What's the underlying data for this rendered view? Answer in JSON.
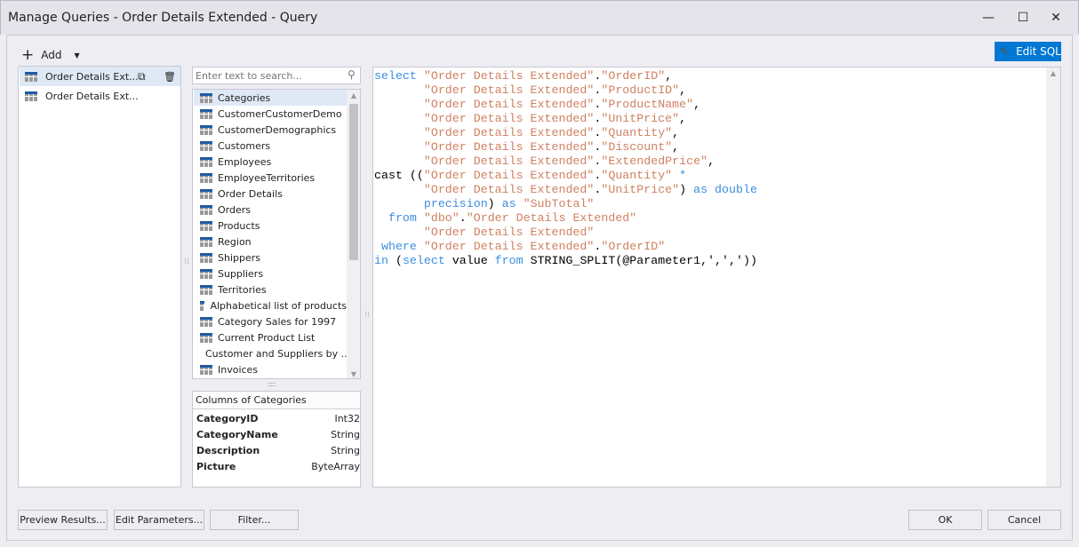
{
  "window": {
    "title": "Manage Queries - Order Details Extended - Query",
    "minimize": "—",
    "maximize": "☐",
    "close": "✕"
  },
  "toolbar": {
    "add_label": "Add",
    "edit_sql_label": "Edit SQL"
  },
  "queries": [
    {
      "label": "Order Details Ext..."
    },
    {
      "label": "Order Details Ext..."
    }
  ],
  "search": {
    "placeholder": "Enter text to search..."
  },
  "tables": [
    {
      "label": "Categories"
    },
    {
      "label": "CustomerCustomerDemo"
    },
    {
      "label": "CustomerDemographics"
    },
    {
      "label": "Customers"
    },
    {
      "label": "Employees"
    },
    {
      "label": "EmployeeTerritories"
    },
    {
      "label": "Order Details"
    },
    {
      "label": "Orders"
    },
    {
      "label": "Products"
    },
    {
      "label": "Region"
    },
    {
      "label": "Shippers"
    },
    {
      "label": "Suppliers"
    },
    {
      "label": "Territories"
    },
    {
      "label": "Alphabetical list of products"
    },
    {
      "label": "Category Sales for 1997"
    },
    {
      "label": "Current Product List"
    },
    {
      "label": "Customer and Suppliers by ..."
    },
    {
      "label": "Invoices"
    }
  ],
  "columns": {
    "header": "Columns of Categories",
    "rows": [
      {
        "name": "CategoryID",
        "type": "Int32"
      },
      {
        "name": "CategoryName",
        "type": "String"
      },
      {
        "name": "Description",
        "type": "String"
      },
      {
        "name": "Picture",
        "type": "ByteArray"
      }
    ]
  },
  "sql": [
    [
      [
        "kw",
        "select "
      ],
      [
        "st",
        "\"Order Details Extended\""
      ],
      [
        "",
        "."
      ],
      [
        "st",
        "\"OrderID\""
      ],
      [
        "",
        ","
      ]
    ],
    [
      [
        "",
        "       "
      ],
      [
        "st",
        "\"Order Details Extended\""
      ],
      [
        "",
        "."
      ],
      [
        "st",
        "\"ProductID\""
      ],
      [
        "",
        ","
      ]
    ],
    [
      [
        "",
        "       "
      ],
      [
        "st",
        "\"Order Details Extended\""
      ],
      [
        "",
        "."
      ],
      [
        "st",
        "\"ProductName\""
      ],
      [
        "",
        ","
      ]
    ],
    [
      [
        "",
        "       "
      ],
      [
        "st",
        "\"Order Details Extended\""
      ],
      [
        "",
        "."
      ],
      [
        "st",
        "\"UnitPrice\""
      ],
      [
        "",
        ","
      ]
    ],
    [
      [
        "",
        "       "
      ],
      [
        "st",
        "\"Order Details Extended\""
      ],
      [
        "",
        "."
      ],
      [
        "st",
        "\"Quantity\""
      ],
      [
        "",
        ","
      ]
    ],
    [
      [
        "",
        "       "
      ],
      [
        "st",
        "\"Order Details Extended\""
      ],
      [
        "",
        "."
      ],
      [
        "st",
        "\"Discount\""
      ],
      [
        "",
        ","
      ]
    ],
    [
      [
        "",
        "       "
      ],
      [
        "st",
        "\"Order Details Extended\""
      ],
      [
        "",
        "."
      ],
      [
        "st",
        "\"ExtendedPrice\""
      ],
      [
        "",
        ","
      ]
    ],
    [
      [
        "",
        "cast (("
      ],
      [
        "st",
        "\"Order Details Extended\""
      ],
      [
        "",
        "."
      ],
      [
        "st",
        "\"Quantity\""
      ],
      [
        "kw",
        " *"
      ]
    ],
    [
      [
        "",
        "       "
      ],
      [
        "st",
        "\"Order Details Extended\""
      ],
      [
        "",
        "."
      ],
      [
        "st",
        "\"UnitPrice\""
      ],
      [
        "",
        ") "
      ],
      [
        "kw",
        "as double"
      ]
    ],
    [
      [
        "kw",
        "       precision"
      ],
      [
        "",
        ") "
      ],
      [
        "kw",
        "as "
      ],
      [
        "st",
        "\"SubTotal\""
      ]
    ],
    [
      [
        "kw",
        "  from "
      ],
      [
        "st",
        "\"dbo\""
      ],
      [
        "",
        "."
      ],
      [
        "st",
        "\"Order Details Extended\""
      ]
    ],
    [
      [
        "",
        "       "
      ],
      [
        "st",
        "\"Order Details Extended\""
      ]
    ],
    [
      [
        "kw",
        " where "
      ],
      [
        "st",
        "\"Order Details Extended\""
      ],
      [
        "",
        "."
      ],
      [
        "st",
        "\"OrderID\""
      ]
    ],
    [
      [
        "kw",
        "in "
      ],
      [
        "",
        "("
      ],
      [
        "kw",
        "select "
      ],
      [
        "",
        "value "
      ],
      [
        "kw",
        "from "
      ],
      [
        "",
        "STRING_SPLIT(@Parameter1,',','))"
      ]
    ]
  ],
  "footer": {
    "preview_label": "Preview Results...",
    "edit_params_label": "Edit Parameters...",
    "filter_label": "Filter...",
    "ok_label": "OK",
    "cancel_label": "Cancel"
  },
  "colors": {
    "accent": "#0078d4",
    "keyword": "#3c8ee0",
    "string": "#d08060",
    "selection": "#dfe9f6"
  }
}
